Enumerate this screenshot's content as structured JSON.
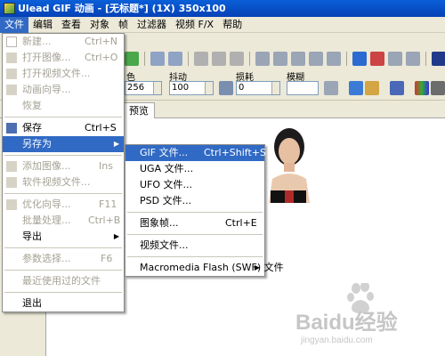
{
  "window": {
    "title": "Ulead GIF 动画 - [无标题*] (1X) 350x100"
  },
  "menubar": {
    "items": [
      {
        "label": "文件",
        "active": true
      },
      {
        "label": "编辑"
      },
      {
        "label": "查看"
      },
      {
        "label": "对象"
      },
      {
        "label": "帧"
      },
      {
        "label": "过滤器"
      },
      {
        "label": "视频 F/X"
      },
      {
        "label": "帮助"
      }
    ]
  },
  "toolbar": {
    "label_color": "色",
    "label_dither": "抖动",
    "label_loss": "损耗",
    "label_blur": "模糊",
    "colors_value": "256",
    "dither_value": "100",
    "loss_value": "0"
  },
  "tabs": {
    "preview": "预览"
  },
  "file_menu": {
    "items": [
      {
        "icon": "new-icon",
        "label": "新建...",
        "accel": "Ctrl+N",
        "disabled": true
      },
      {
        "icon": "open-image-icon",
        "label": "打开图像...",
        "accel": "Ctrl+O",
        "disabled": true
      },
      {
        "icon": "open-video-icon",
        "label": "打开视频文件...",
        "accel": "",
        "disabled": true
      },
      {
        "icon": "animation-wizard-icon",
        "label": "动画向导...",
        "accel": "",
        "disabled": true
      },
      {
        "icon": "",
        "label": "恢复",
        "accel": "",
        "disabled": true
      },
      {
        "sep": true
      },
      {
        "icon": "save-icon",
        "label": "保存",
        "accel": "Ctrl+S",
        "disabled": false
      },
      {
        "icon": "",
        "label": "另存为",
        "accel": "",
        "disabled": false,
        "submenu": true,
        "highlighted": true
      },
      {
        "sep": true
      },
      {
        "icon": "add-image-icon",
        "label": "添加图像...",
        "accel": "Ins",
        "disabled": true
      },
      {
        "icon": "video-file-icon",
        "label": "软件视频文件...",
        "accel": "",
        "disabled": true
      },
      {
        "sep": true
      },
      {
        "icon": "optimize-wizard-icon",
        "label": "优化向导...",
        "accel": "F11",
        "disabled": true
      },
      {
        "icon": "",
        "label": "批量处理...",
        "accel": "Ctrl+B",
        "disabled": true
      },
      {
        "icon": "",
        "label": "导出",
        "accel": "",
        "disabled": false,
        "submenu": true
      },
      {
        "sep": true
      },
      {
        "icon": "",
        "label": "参数选择...",
        "accel": "F6",
        "disabled": true
      },
      {
        "sep": true
      },
      {
        "icon": "",
        "label": "最近使用过的文件",
        "accel": "",
        "disabled": true
      },
      {
        "sep": true
      },
      {
        "icon": "",
        "label": "退出",
        "accel": "",
        "disabled": false
      }
    ]
  },
  "saveas_menu": {
    "items": [
      {
        "label": "GIF 文件...",
        "accel": "Ctrl+Shift+S",
        "highlighted": true
      },
      {
        "label": "UGA 文件..."
      },
      {
        "label": "UFO 文件..."
      },
      {
        "label": "PSD 文件..."
      },
      {
        "sep": true
      },
      {
        "label": "图象帧...",
        "accel": "Ctrl+E"
      },
      {
        "sep": true
      },
      {
        "label": "视频文件..."
      },
      {
        "sep": true
      },
      {
        "label": "Macromedia Flash (SWF) 文件",
        "submenu": true
      }
    ]
  },
  "watermark": {
    "logo": "Baidu经验",
    "url": "jingyan.baidu.com"
  },
  "colors": {
    "highlight": "#316ac5",
    "title_bar": "#0a5fd8",
    "chrome": "#ece9d8"
  }
}
